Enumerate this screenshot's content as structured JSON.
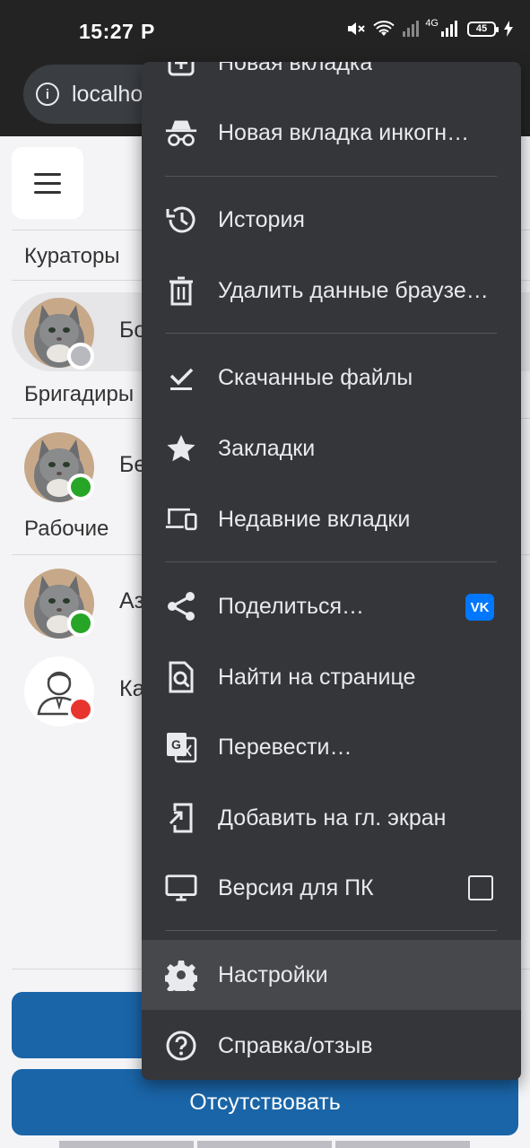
{
  "status_bar": {
    "time": "15:27",
    "carrier_icon": "P",
    "network": "4G",
    "battery": "45"
  },
  "browser": {
    "url": "localhost"
  },
  "app": {
    "sections": {
      "curators": "Кураторы",
      "foremen": "Бригадиры",
      "workers": "Рабочие"
    },
    "users": [
      {
        "name": "Бо",
        "status": "offline",
        "status_color": "#b7b9bf",
        "avatar": "cat-photo"
      },
      {
        "name": "Бе",
        "status": "online",
        "status_color": "#27a527",
        "avatar": "cat-photo"
      },
      {
        "name": "Аз",
        "status": "online",
        "status_color": "#27a527",
        "avatar": "cat-photo"
      },
      {
        "name": "Ка",
        "status": "busy",
        "status_color": "#e8342e",
        "avatar": "person-placeholder"
      }
    ],
    "buttons": {
      "absent": "Отсутствовать"
    }
  },
  "menu": {
    "items": [
      {
        "label": "Новая вкладка",
        "icon": "new-tab-icon"
      },
      {
        "label": "Новая вкладка инкогн…",
        "icon": "incognito-icon"
      },
      {
        "label": "История",
        "icon": "history-icon"
      },
      {
        "label": "Удалить данные браузе…",
        "icon": "trash-icon"
      },
      {
        "label": "Скачанные файлы",
        "icon": "downloads-icon"
      },
      {
        "label": "Закладки",
        "icon": "star-icon"
      },
      {
        "label": "Недавние вкладки",
        "icon": "devices-icon"
      },
      {
        "label": "Поделиться…",
        "icon": "share-icon",
        "badge": "vk"
      },
      {
        "label": "Найти на странице",
        "icon": "find-in-page-icon"
      },
      {
        "label": "Перевести…",
        "icon": "translate-icon"
      },
      {
        "label": "Добавить на гл. экран",
        "icon": "add-to-home-icon"
      },
      {
        "label": "Версия для ПК",
        "icon": "desktop-icon",
        "checked": false
      },
      {
        "label": "Настройки",
        "icon": "settings-icon"
      },
      {
        "label": "Справка/отзыв",
        "icon": "help-icon"
      }
    ]
  },
  "colors": {
    "primary": "#1a65a8",
    "menu_bg": "#35363a",
    "menu_selected": "#47484c",
    "vk": "#0077ff"
  }
}
